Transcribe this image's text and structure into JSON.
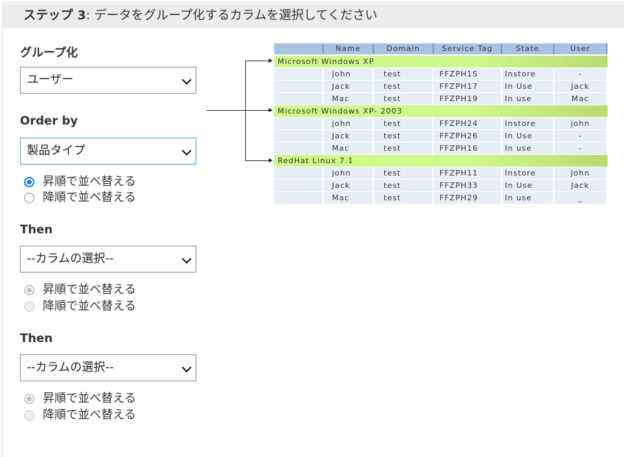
{
  "header": {
    "step": "ステップ 3",
    "title": ": データをグループ化するカラムを選択してください"
  },
  "group_by": {
    "label": "グループ化",
    "value": "ユーザー"
  },
  "order_by": {
    "label": "Order by",
    "value": "製品タイプ",
    "asc": "昇順で並べ替える",
    "desc": "降順で並べ替える"
  },
  "then1": {
    "label": "Then",
    "value": "--カラムの選択--",
    "asc": "昇順で並べ替える",
    "desc": "降順で並べ替える"
  },
  "then2": {
    "label": "Then",
    "value": "--カラムの選択--",
    "asc": "昇順で並べ替える",
    "desc": "降順で並べ替える"
  },
  "preview": {
    "columns": [
      "Name",
      "Domain",
      "Service Tag",
      "State",
      "User"
    ],
    "groups": [
      {
        "title": "Microsoft Windows XP",
        "rows": [
          [
            "john",
            "test",
            "FFZPH1S",
            "Instore",
            "-"
          ],
          [
            "Jack",
            "test",
            "FFZPH17",
            "In Use",
            "Jack"
          ],
          [
            "Mac",
            "test",
            "FFZPH19",
            "In use",
            "Mac"
          ]
        ]
      },
      {
        "title": "Microsoft Windows XP- 2003",
        "rows": [
          [
            "john",
            "test",
            "FFZPH24",
            "Instore",
            "john"
          ],
          [
            "Jack",
            "test",
            "FFZPH26",
            "In Use",
            "-"
          ],
          [
            "Mac",
            "test",
            "FFZPH16",
            "In use",
            "-"
          ]
        ]
      },
      {
        "title": "RedHat Linux 7.1",
        "rows": [
          [
            "john",
            "test",
            "FFZPH11",
            "Instore",
            "John"
          ],
          [
            "Jack",
            "test",
            "FFZPH33",
            "In Use",
            "Jack"
          ],
          [
            "Mac",
            "test",
            "FFZPH29",
            "In use",
            "_"
          ]
        ]
      }
    ]
  }
}
